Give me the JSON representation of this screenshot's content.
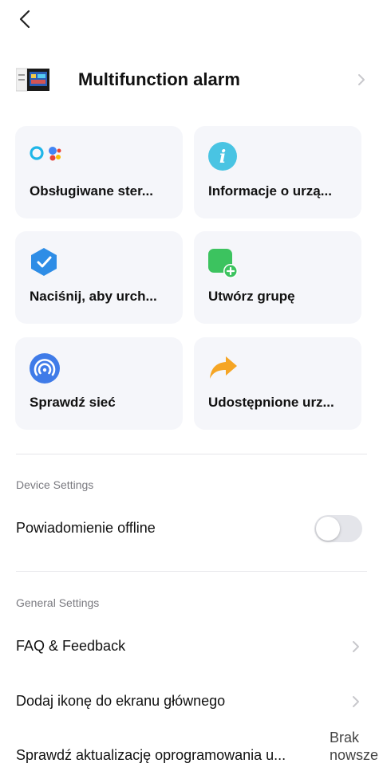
{
  "header": {
    "device_name": "Multifunction alarm"
  },
  "cards": [
    {
      "label": "Obsługiwane ster...",
      "icon": "voice-assistants-icon"
    },
    {
      "label": "Informacje o urzą...",
      "icon": "info-icon"
    },
    {
      "label": "Naciśnij, aby urch...",
      "icon": "tap-to-run-icon"
    },
    {
      "label": "Utwórz grupę",
      "icon": "create-group-icon"
    },
    {
      "label": "Sprawdź sieć",
      "icon": "network-check-icon"
    },
    {
      "label": "Udostępnione urz...",
      "icon": "share-icon"
    }
  ],
  "device_settings": {
    "title": "Device Settings",
    "offline_notification": {
      "label": "Powiadomienie offline",
      "enabled": false
    }
  },
  "general_settings": {
    "title": "General Settings",
    "faq": "FAQ & Feedback",
    "add_icon": "Dodaj ikonę do ekranu głównego",
    "firmware": {
      "label": "Sprawdź aktualizację oprogramowania u...",
      "value_line1": "Brak",
      "value_line2": "nowsze"
    }
  },
  "colors": {
    "card_bg": "#f5f6fa",
    "toggle_off": "#e4e5ea",
    "accent_green": "#3cc35f",
    "accent_blue": "#2e8de6"
  }
}
